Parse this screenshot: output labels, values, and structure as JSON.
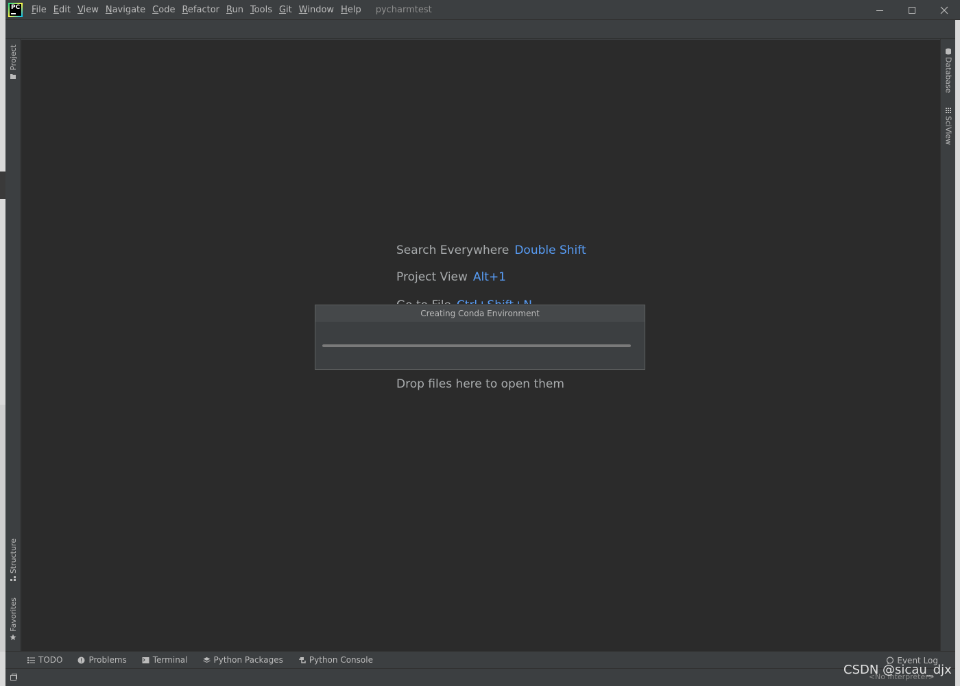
{
  "app": {
    "logo_text": "PC",
    "project_name": "pycharmtest"
  },
  "menu": {
    "items": [
      {
        "mnemonic": "F",
        "rest": "ile"
      },
      {
        "mnemonic": "E",
        "rest": "dit"
      },
      {
        "mnemonic": "V",
        "rest": "iew"
      },
      {
        "mnemonic": "N",
        "rest": "avigate"
      },
      {
        "mnemonic": "C",
        "rest": "ode"
      },
      {
        "mnemonic": "R",
        "rest": "efactor"
      },
      {
        "mnemonic": "R",
        "rest": "un"
      },
      {
        "mnemonic": "T",
        "rest": "ools"
      },
      {
        "mnemonic": "G",
        "rest": "it"
      },
      {
        "mnemonic": "W",
        "rest": "indow"
      },
      {
        "mnemonic": "H",
        "rest": "elp"
      }
    ]
  },
  "left_tabs": {
    "project": "Project",
    "structure": "Structure",
    "favorites": "Favorites"
  },
  "right_tabs": {
    "database": "Database",
    "sciview": "SciView"
  },
  "editor": {
    "hints": [
      {
        "label": "Search Everywhere",
        "shortcut": "Double Shift"
      },
      {
        "label": "Project View",
        "shortcut": "Alt+1"
      },
      {
        "label": "Go to File",
        "shortcut": "Ctrl+Shift+N"
      }
    ],
    "drop_text": "Drop files here to open them"
  },
  "dialog": {
    "title": "Creating Conda Environment",
    "progress": 1.0
  },
  "bottom_tabs": {
    "todo": "TODO",
    "problems": "Problems",
    "terminal": "Terminal",
    "python_packages": "Python Packages",
    "python_console": "Python Console",
    "event_log": "Event Log"
  },
  "status": {
    "right_text": "<No interpreter>"
  },
  "watermark": "CSDN @sicau_djx",
  "colors": {
    "accent_shortcut": "#589df6",
    "editor_bg": "#2b2b2b",
    "chrome_bg": "#3c3f41"
  }
}
